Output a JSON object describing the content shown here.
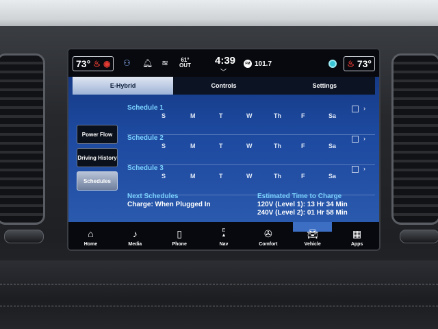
{
  "status_bar": {
    "driver_temp": "73°",
    "passenger_temp": "73°",
    "outside_temp": "61°",
    "outside_label": "OUT",
    "time": "4:39",
    "radio_band": "FM",
    "radio_station": "101.7"
  },
  "tabs": [
    {
      "label": "E-Hybrid",
      "active": true
    },
    {
      "label": "Controls",
      "active": false
    },
    {
      "label": "Settings",
      "active": false
    }
  ],
  "side_menu": [
    {
      "label": "Power Flow",
      "selected": false
    },
    {
      "label": "Driving History",
      "selected": false
    },
    {
      "label": "Schedules",
      "selected": true
    }
  ],
  "schedules": [
    {
      "name": "Schedule 1",
      "days": [
        "S",
        "M",
        "T",
        "W",
        "Th",
        "F",
        "Sa"
      ],
      "enabled": false
    },
    {
      "name": "Schedule 2",
      "days": [
        "S",
        "M",
        "T",
        "W",
        "Th",
        "F",
        "Sa"
      ],
      "enabled": false
    },
    {
      "name": "Schedule 3",
      "days": [
        "S",
        "M",
        "T",
        "W",
        "Th",
        "F",
        "Sa"
      ],
      "enabled": false
    }
  ],
  "next_schedules": {
    "title": "Next Schedules",
    "value": "Charge: When Plugged In"
  },
  "estimated_charge": {
    "title": "Estimated Time to Charge",
    "level1": "120V (Level 1): 13 Hr 34 Min",
    "level2": "240V (Level 2): 01 Hr 58 Min"
  },
  "nav_bar": [
    {
      "label": "Home",
      "icon": "home-icon",
      "active": false
    },
    {
      "label": "Media",
      "icon": "music-note-icon",
      "active": false
    },
    {
      "label": "Phone",
      "icon": "phone-icon",
      "active": false
    },
    {
      "label": "Nav",
      "icon": "navigation-icon",
      "compass": "E",
      "active": false
    },
    {
      "label": "Comfort",
      "icon": "climate-fan-icon",
      "active": false
    },
    {
      "label": "Vehicle",
      "icon": "car-icon",
      "active": true
    },
    {
      "label": "Apps",
      "icon": "apps-grid-icon",
      "active": false
    }
  ],
  "colors": {
    "accent_heading": "#7bd2ff",
    "content_background": "#1d4aa0",
    "seat_heat": "#e23a33",
    "active_nav": "#3c6fc4"
  }
}
